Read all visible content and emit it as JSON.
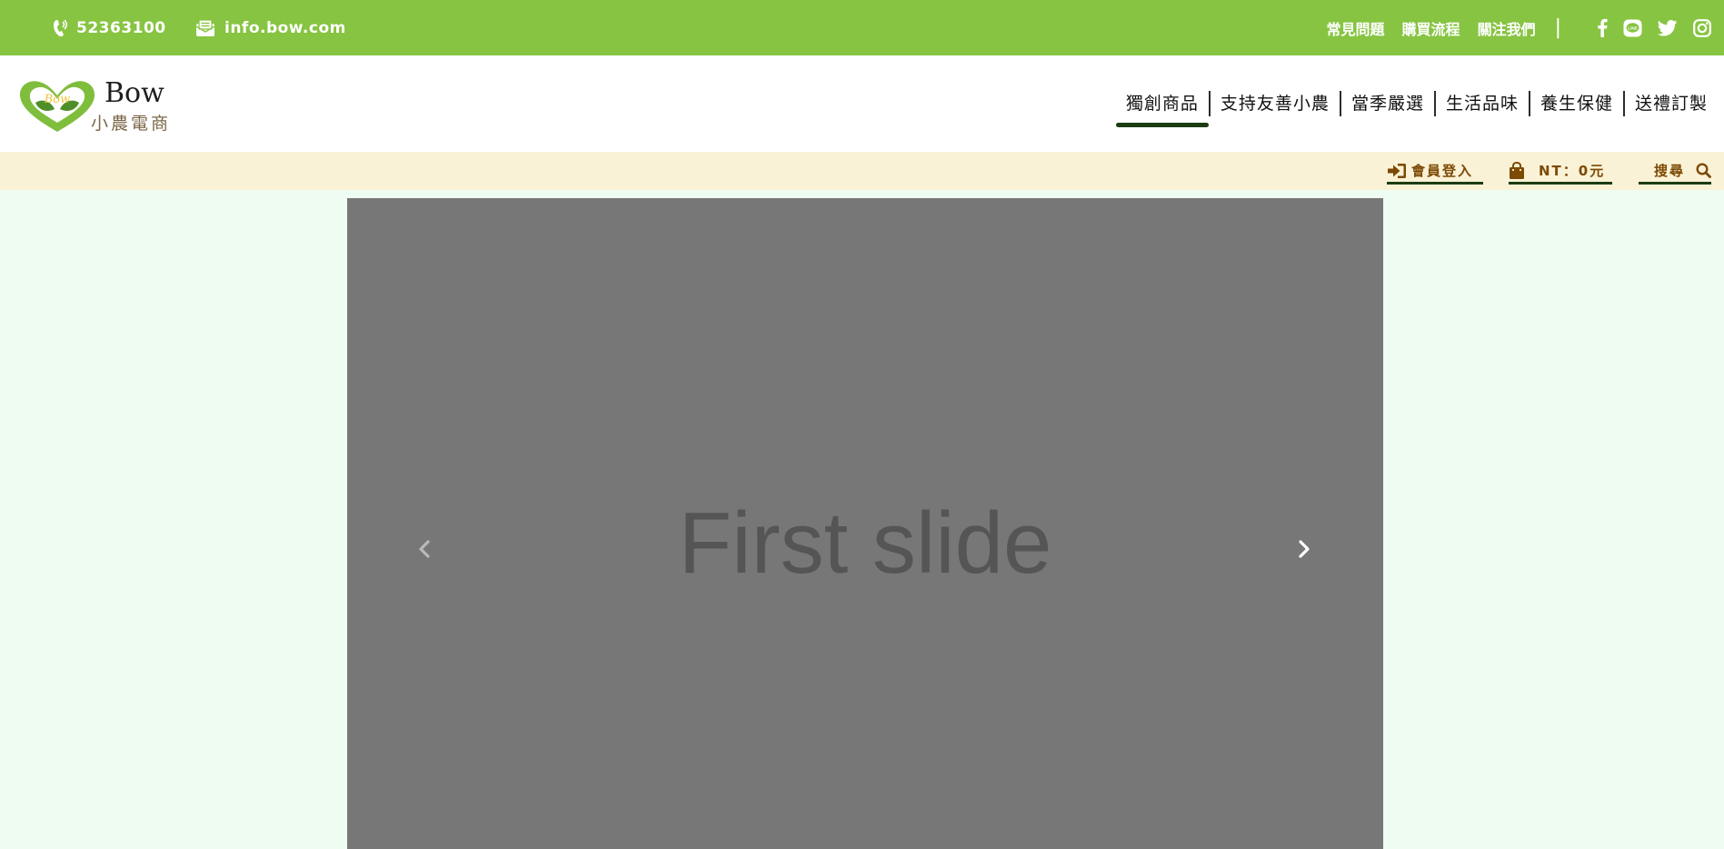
{
  "topbar": {
    "phone": "52363100",
    "email": "info.bow.com",
    "links": [
      "常見問題",
      "購買流程",
      "關注我們"
    ],
    "separator": "|",
    "social": [
      "facebook-icon",
      "line-icon",
      "twitter-icon",
      "instagram-icon"
    ],
    "bg_color": "#87c442"
  },
  "header": {
    "logo_badge": "Bow",
    "brand": "Bow",
    "brand_sub": "小農電商",
    "nav": [
      "獨創商品",
      "支持友善小農",
      "當季嚴選",
      "生活品味",
      "養生保健",
      "送禮訂製"
    ],
    "active_nav": "獨創商品"
  },
  "utility": {
    "login": "會員登入",
    "cart": "NT：0元",
    "search": "搜尋",
    "accent_color": "#7c4a05"
  },
  "carousel": {
    "slide_text": "First slide",
    "bg_color": "#777777"
  }
}
